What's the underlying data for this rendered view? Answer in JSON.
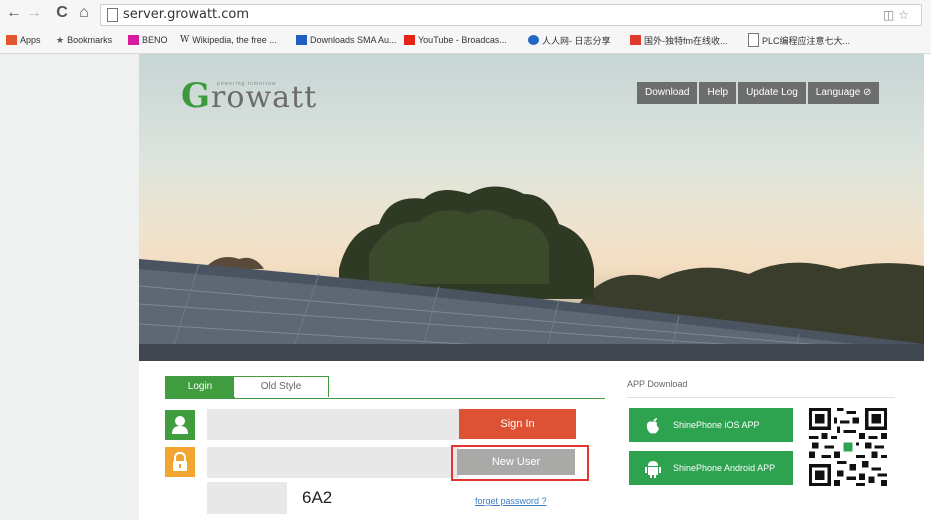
{
  "browser": {
    "url": "server.growatt.com",
    "nav": {
      "back": "←",
      "forward": "→",
      "reload": "C",
      "home": "⌂"
    },
    "bookmarks": [
      {
        "label": "Apps",
        "icon": "apps-grid-icon",
        "color": "#e4572e"
      },
      {
        "label": "Bookmarks",
        "icon": "star-icon",
        "color": "#555555"
      },
      {
        "label": "BENO",
        "icon": "folder-icon",
        "color": "#d81b9b"
      },
      {
        "label": "Wikipedia, the free ...",
        "icon": "wikipedia-icon",
        "color": "#333333"
      },
      {
        "label": "Downloads SMA Au...",
        "icon": "sma-icon",
        "color": "#1f5fbf"
      },
      {
        "label": "YouTube - Broadcas...",
        "icon": "youtube-icon",
        "color": "#e62117"
      },
      {
        "label": "人人网- 日志分享",
        "icon": "renren-icon",
        "color": "#2369c4"
      },
      {
        "label": "国外-独特fm在线收...",
        "icon": "radio-icon",
        "color": "#e23a2a"
      },
      {
        "label": "PLC编程应注意七大...",
        "icon": "page-icon",
        "color": "#777777"
      }
    ]
  },
  "header": {
    "logo_first": "G",
    "logo_rest": "rowatt",
    "logo_tagline": "powering tomorrow",
    "nav": [
      "Download",
      "Help",
      "Update Log",
      "Language ⊘"
    ]
  },
  "login": {
    "tabs": [
      "Login",
      "Old Style"
    ],
    "username": "",
    "password": "",
    "captcha_value": "",
    "captcha_code": "6A2",
    "signin_label": "Sign In",
    "newuser_label": "New User",
    "forgot_label": "forget password ?"
  },
  "app": {
    "title": "APP Download",
    "ios_label": "ShinePhone iOS APP",
    "android_label": "ShinePhone Android APP"
  },
  "colors": {
    "brand_green": "#3f9c3f",
    "signin_red": "#dd5134",
    "highlight_red": "#e4352f",
    "lock_orange": "#f3a531"
  }
}
